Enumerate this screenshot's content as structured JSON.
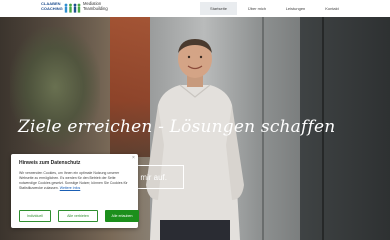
{
  "brand": {
    "name_line1": "CLAABEN",
    "name_line2": "COACHING",
    "service_line1": "Mediation",
    "service_line2": "Teambuilding"
  },
  "nav": {
    "items": [
      {
        "label": "Startseite",
        "active": true
      },
      {
        "label": "Über mich",
        "active": false
      },
      {
        "label": "Leistungen",
        "active": false
      },
      {
        "label": "Kontakt",
        "active": false
      }
    ]
  },
  "hero": {
    "title": "Ziele erreichen - Lösungen schaffen",
    "cta_label": "mir auf."
  },
  "cookie": {
    "title": "Hinweis zum Datenschutz",
    "close_symbol": "×",
    "text": "Wir verwenden Cookies, um Ihnen ein optimale Nutzung unserer Webseite zu ermöglichen. Es werden für den Betrieb der Seite notwendige Cookies gesetzt. Sonstige Nutzer, können Sie Cookies für Statistikzwecke",
    "link_prefix": "zulassen.",
    "link_label": "Weitere Infos",
    "buttons": {
      "individual": "Individuell",
      "reject": "Alle verbieten",
      "accept": "Alle erlauben"
    }
  },
  "colors": {
    "accent_green": "#1c8f1c",
    "logo_blue": "#1f4f8f"
  }
}
